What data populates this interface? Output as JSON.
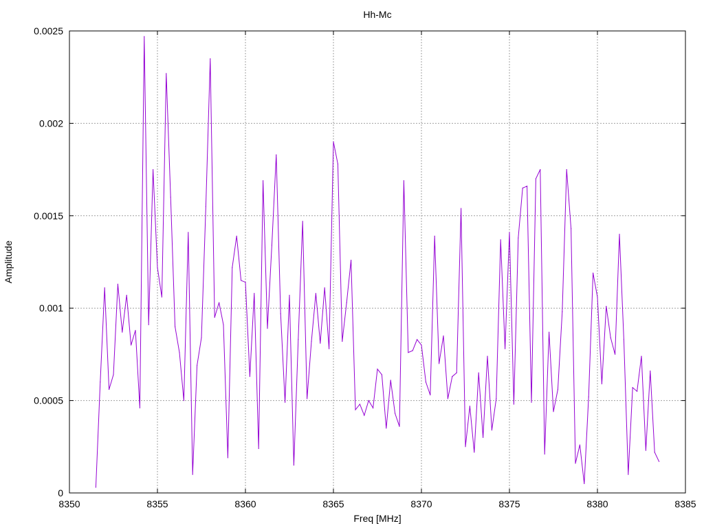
{
  "chart_data": {
    "type": "line",
    "title": "Hh-Mc",
    "xlabel": "Freq [MHz]",
    "ylabel": "Amplitude",
    "xlim": [
      8350,
      8385
    ],
    "ylim": [
      0,
      0.0025
    ],
    "xticks": [
      "8350",
      "8355",
      "8360",
      "8365",
      "8370",
      "8375",
      "8380",
      "8385"
    ],
    "yticks": [
      "0",
      "0.0005",
      "0.001",
      "0.0015",
      "0.002",
      "0.0025"
    ],
    "grid": true,
    "series": [
      {
        "color": "#9400d3",
        "x": [
          8351.5,
          8351.75,
          8352.0,
          8352.25,
          8352.5,
          8352.75,
          8353.0,
          8353.25,
          8353.5,
          8353.75,
          8354.0,
          8354.25,
          8354.5,
          8354.75,
          8355.0,
          8355.25,
          8355.5,
          8355.75,
          8356.0,
          8356.25,
          8356.5,
          8356.75,
          8357.0,
          8357.25,
          8357.5,
          8357.75,
          8358.0,
          8358.25,
          8358.5,
          8358.75,
          8359.0,
          8359.25,
          8359.5,
          8359.75,
          8360.0,
          8360.25,
          8360.5,
          8360.75,
          8361.0,
          8361.25,
          8361.5,
          8361.75,
          8362.0,
          8362.25,
          8362.5,
          8362.75,
          8363.0,
          8363.25,
          8363.5,
          8363.75,
          8364.0,
          8364.25,
          8364.5,
          8364.75,
          8365.0,
          8365.25,
          8365.5,
          8365.75,
          8366.0,
          8366.25,
          8366.5,
          8366.75,
          8367.0,
          8367.25,
          8367.5,
          8367.75,
          8368.0,
          8368.25,
          8368.5,
          8368.75,
          8369.0,
          8369.25,
          8369.5,
          8369.75,
          8370.0,
          8370.25,
          8370.5,
          8370.75,
          8371.0,
          8371.25,
          8371.5,
          8371.75,
          8372.0,
          8372.25,
          8372.5,
          8372.75,
          8373.0,
          8373.25,
          8373.5,
          8373.75,
          8374.0,
          8374.25,
          8374.5,
          8374.75,
          8375.0,
          8375.25,
          8375.5,
          8375.75,
          8376.0,
          8376.25,
          8376.5,
          8376.75,
          8377.0,
          8377.25,
          8377.5,
          8377.75,
          8378.0,
          8378.25,
          8378.5,
          8378.75,
          8379.0,
          8379.25,
          8379.5,
          8379.75,
          8380.0,
          8380.25,
          8380.5,
          8380.75,
          8381.0,
          8381.25,
          8381.5,
          8381.75,
          8382.0,
          8382.25,
          8382.5,
          8382.75,
          8383.0,
          8383.25,
          8383.5
        ],
        "y": [
          3e-05,
          0.0006,
          0.00111,
          0.00056,
          0.00064,
          0.00113,
          0.00087,
          0.00107,
          0.0008,
          0.00088,
          0.00046,
          0.00247,
          0.00091,
          0.00175,
          0.00122,
          0.00106,
          0.00227,
          0.0016,
          0.0009,
          0.00076,
          0.0005,
          0.00141,
          0.0001,
          0.00069,
          0.00084,
          0.00155,
          0.00235,
          0.00095,
          0.00103,
          0.00091,
          0.00019,
          0.00122,
          0.00139,
          0.00115,
          0.00114,
          0.00063,
          0.00108,
          0.00024,
          0.00169,
          0.00089,
          0.00134,
          0.00183,
          0.00097,
          0.00049,
          0.00107,
          0.00015,
          0.00083,
          0.00147,
          0.00051,
          0.00082,
          0.00108,
          0.00081,
          0.00111,
          0.00078,
          0.0019,
          0.00178,
          0.00082,
          0.00103,
          0.00126,
          0.00045,
          0.00048,
          0.00042,
          0.0005,
          0.00046,
          0.00067,
          0.00064,
          0.00035,
          0.00061,
          0.00043,
          0.00036,
          0.00169,
          0.00076,
          0.00077,
          0.00083,
          0.0008,
          0.0006,
          0.00053,
          0.00139,
          0.0007,
          0.00085,
          0.00051,
          0.00063,
          0.00065,
          0.00154,
          0.00025,
          0.00047,
          0.00022,
          0.00065,
          0.0003,
          0.00074,
          0.00034,
          0.00051,
          0.00137,
          0.00078,
          0.00141,
          0.00048,
          0.00138,
          0.00165,
          0.00166,
          0.00049,
          0.0017,
          0.00175,
          0.00021,
          0.00087,
          0.00044,
          0.00056,
          0.00098,
          0.00175,
          0.00143,
          0.00016,
          0.00026,
          5e-05,
          0.00052,
          0.00119,
          0.00106,
          0.00059,
          0.00101,
          0.00084,
          0.00075,
          0.0014,
          0.00083,
          0.0001,
          0.00057,
          0.00055,
          0.00074,
          0.00023,
          0.00066,
          0.00022,
          0.00017
        ]
      }
    ]
  }
}
